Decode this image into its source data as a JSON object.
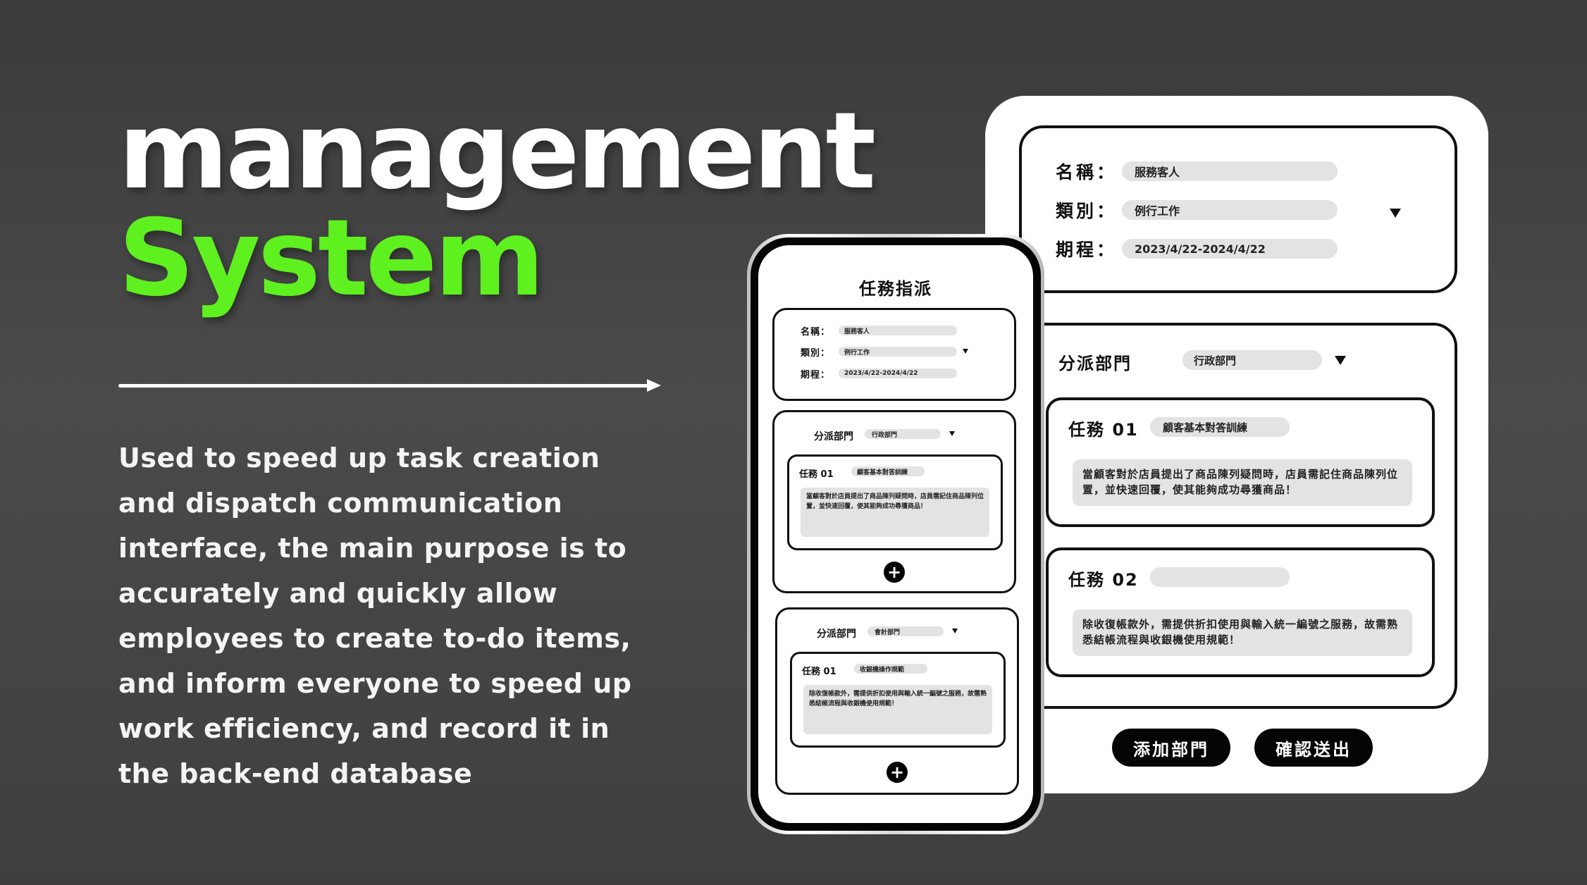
{
  "hero": {
    "title": "management",
    "subtitle": "System",
    "description": "Used to speed up task creation and dispatch communication interface, the main purpose is to accurately and quickly allow employees to create to-do items, and inform everyone to speed up work efficiency, and record it in the back-end database"
  },
  "colors": {
    "accent": "#5ff020",
    "background": "#444444",
    "button": "#050505",
    "field": "#e3e3e3"
  },
  "form": {
    "name_label": "名稱：",
    "name_value": "服務客人",
    "type_label": "類別：",
    "type_value": "例行工作",
    "period_label": "期程：",
    "period_value": "2023/4/22-2024/4/22"
  },
  "desktop": {
    "dept_label": "分派部門",
    "dept_value": "行政部門",
    "tasks": [
      {
        "name": "任務 01",
        "title": "顧客基本對答訓練",
        "body": "當顧客對於店員提出了商品陳列疑問時，店員需記住商品陳列位置，並快速回覆，使其能夠成功尋獲商品！"
      },
      {
        "name": "任務 02",
        "title": "",
        "body": "除收復帳款外，需提供折扣使用與輸入統一編號之服務，故需熟悉結帳流程與收銀機使用規範！"
      }
    ],
    "add_dept_button": "添加部門",
    "submit_button": "確認送出"
  },
  "phone": {
    "screen_title": "任務指派",
    "depts": [
      {
        "label": "分派部門",
        "value": "行政部門",
        "task_name": "任務 01",
        "task_title": "顧客基本對答訓練",
        "task_body": "當顧客對於店員提出了商品陳列疑問時，店員需記住商品陳列位置，並快速回覆，使其能夠成功尋獲商品！"
      },
      {
        "label": "分派部門",
        "value": "會計部門",
        "task_name": "任務 01",
        "task_title": "收銀機操作規範",
        "task_body": "除收復帳款外，需提供折扣使用與輸入統一編號之服務，故需熟悉結帳流程與收銀機使用規範！"
      }
    ],
    "plus_symbol": "+"
  }
}
